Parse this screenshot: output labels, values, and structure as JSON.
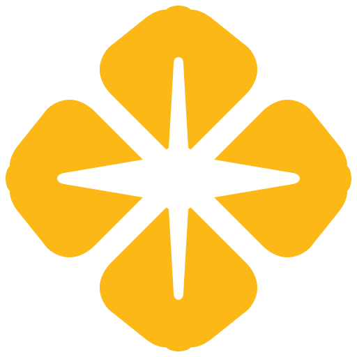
{
  "logo": {
    "icon": "four-petal-flower-with-star-icon",
    "colors": {
      "petal": "#FBB817",
      "star": "#FFFFFF",
      "background": "#FFFFFF"
    }
  }
}
